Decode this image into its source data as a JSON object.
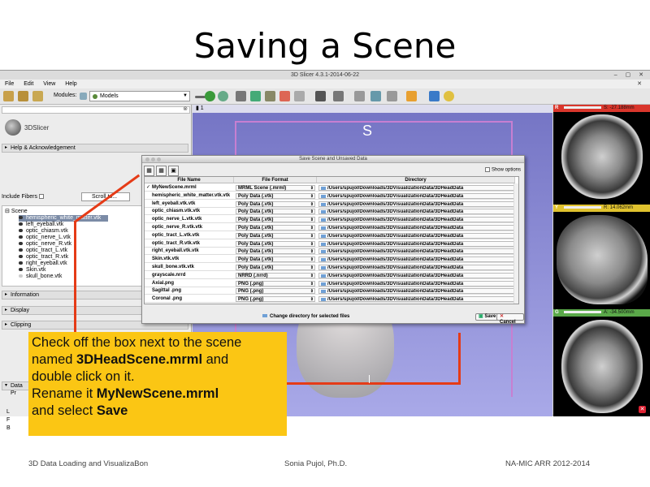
{
  "slide": {
    "title": "Saving a Scene",
    "footer_left": "3D Data Loading and VisualizaBon",
    "footer_center": "Sonia Pujol, Ph.D.",
    "footer_right": "NA-MIC ARR 2012-2014"
  },
  "window": {
    "title": "3D Slicer 4.3.1-2014-06-22",
    "menu": [
      "File",
      "Edit",
      "View",
      "Help"
    ],
    "modules_label": "Modules:",
    "module_selected": "Models"
  },
  "left_panel": {
    "logo_text": "3DSlicer",
    "help_section": "Help & Acknowledgement",
    "include_fibers": "Include Fibers",
    "scroll_to": "Scroll to...",
    "scene_root": "Scene",
    "scene_items": [
      "hemispheric_white_matter.vtk",
      "left_eyeball.vtk",
      "optic_chiasm.vtk",
      "optic_nerve_L.vtk",
      "optic_nerve_R.vtk",
      "optic_tract_L.vtk",
      "optic_tract_R.vtk",
      "right_eyeball.vtk",
      "Skin.vtk",
      "skull_bone.vtk"
    ],
    "sections": [
      "Information",
      "Display",
      "Clipping",
      "Data Pr"
    ],
    "letters": [
      "L",
      "F",
      "B"
    ]
  },
  "view3d": {
    "orientation": "S",
    "tab_number": "1"
  },
  "slices": {
    "red": {
      "letter": "R",
      "value": "S: -27.188mm",
      "color": "#d9362c"
    },
    "yellow": {
      "letter": "Y",
      "value": "R: 14.062mm",
      "color": "#e0c22e"
    },
    "green": {
      "letter": "G",
      "value": "A: -34.500mm",
      "color": "#5aa849"
    }
  },
  "dialog": {
    "title": "Save Scene and Unsaved Data",
    "show_options": "Show options",
    "headers": [
      "File Name",
      "File Format",
      "Directory"
    ],
    "rows": [
      {
        "checked": "✓",
        "name": "MyNewScene.mrml",
        "format": "MRML Scene (.mrml)",
        "dir": "/Users/spujol/Downloads/3DVisualizationData/3DHeadData"
      },
      {
        "checked": "",
        "name": "hemispheric_white_matter.vtk.vtk",
        "format": "Poly Data (.vtk)",
        "dir": "/Users/spujol/Downloads/3DVisualizationData/3DHeadData"
      },
      {
        "checked": "",
        "name": "left_eyeball.vtk.vtk",
        "format": "Poly Data (.vtk)",
        "dir": "/Users/spujol/Downloads/3DVisualizationData/3DHeadData"
      },
      {
        "checked": "",
        "name": "optic_chiasm.vtk.vtk",
        "format": "Poly Data (.vtk)",
        "dir": "/Users/spujol/Downloads/3DVisualizationData/3DHeadData"
      },
      {
        "checked": "",
        "name": "optic_nerve_L.vtk.vtk",
        "format": "Poly Data (.vtk)",
        "dir": "/Users/spujol/Downloads/3DVisualizationData/3DHeadData"
      },
      {
        "checked": "",
        "name": "optic_nerve_R.vtk.vtk",
        "format": "Poly Data (.vtk)",
        "dir": "/Users/spujol/Downloads/3DVisualizationData/3DHeadData"
      },
      {
        "checked": "",
        "name": "optic_tract_L.vtk.vtk",
        "format": "Poly Data (.vtk)",
        "dir": "/Users/spujol/Downloads/3DVisualizationData/3DHeadData"
      },
      {
        "checked": "",
        "name": "optic_tract_R.vtk.vtk",
        "format": "Poly Data (.vtk)",
        "dir": "/Users/spujol/Downloads/3DVisualizationData/3DHeadData"
      },
      {
        "checked": "",
        "name": "right_eyeball.vtk.vtk",
        "format": "Poly Data (.vtk)",
        "dir": "/Users/spujol/Downloads/3DVisualizationData/3DHeadData"
      },
      {
        "checked": "",
        "name": "Skin.vtk.vtk",
        "format": "Poly Data (.vtk)",
        "dir": "/Users/spujol/Downloads/3DVisualizationData/3DHeadData"
      },
      {
        "checked": "",
        "name": "skull_bone.vtk.vtk",
        "format": "Poly Data (.vtk)",
        "dir": "/Users/spujol/Downloads/3DVisualizationData/3DHeadData"
      },
      {
        "checked": "",
        "name": "grayscale.nrrd",
        "format": "NRRD (.nrrd)",
        "dir": "/Users/spujol/Downloads/3DVisualizationData/3DHeadData"
      },
      {
        "checked": "",
        "name": "Axial.png",
        "format": "PNG (.png)",
        "dir": "/Users/spujol/Downloads/3DVisualizationData/3DHeadData"
      },
      {
        "checked": "",
        "name": "Sagittal .png",
        "format": "PNG (.png)",
        "dir": "/Users/spujol/Downloads/3DVisualizationData/3DHeadData"
      },
      {
        "checked": "",
        "name": "Coronal .png",
        "format": "PNG (.png)",
        "dir": "/Users/spujol/Downloads/3DVisualizationData/3DHeadData"
      }
    ],
    "change_dir": "Change directory for selected files",
    "save": "Save",
    "cancel": "Cancel"
  },
  "callout": {
    "l1": "Check off the box next to the scene",
    "l2a": "named ",
    "l2b": "3DHeadScene.mrml",
    "l2c": " and",
    "l3": "double click on it.",
    "l4a": "Rename it ",
    "l4b": "MyNewScene.mrml",
    "l5a": "and select ",
    "l5b": "Save"
  }
}
